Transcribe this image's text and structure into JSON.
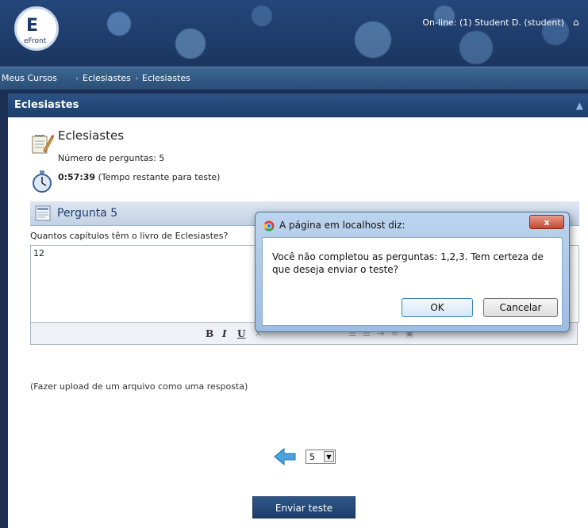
{
  "header": {
    "logo_text": "eFront",
    "online_text": "On-line: (1) Student D. (student)"
  },
  "breadcrumb": {
    "items": [
      "Meus Cursos",
      "Eclesiastes",
      "Eclesiastes"
    ]
  },
  "panel": {
    "title": "Eclesiastes"
  },
  "test": {
    "title": "Eclesiastes",
    "question_count": "Número de perguntas: 5",
    "time_remaining": "0:57:39",
    "time_label": "(Tempo restante para teste)"
  },
  "question": {
    "heading": "Pergunta 5",
    "text": "Quantos capítulos têm o livro de Eclesiastes?",
    "answer": "12"
  },
  "editor_toolbar": {
    "bold": "B",
    "italic": "I",
    "underline": "U"
  },
  "upload_text": "(Fazer upload de um arquivo como uma resposta)",
  "pagination": {
    "current_page": "5"
  },
  "submit_label": "Enviar teste",
  "dialog": {
    "title": "A página em localhost diz:",
    "close_label": "x",
    "message": "Você não completou as perguntas: 1,2,3. Tem certeza de que deseja enviar o teste?",
    "ok_label": "OK",
    "cancel_label": "Cancelar"
  },
  "colors": {
    "header_bg": "#1d3a68",
    "panel_head": "#1c3e6b",
    "dialog_frame": "#9dbde2"
  }
}
